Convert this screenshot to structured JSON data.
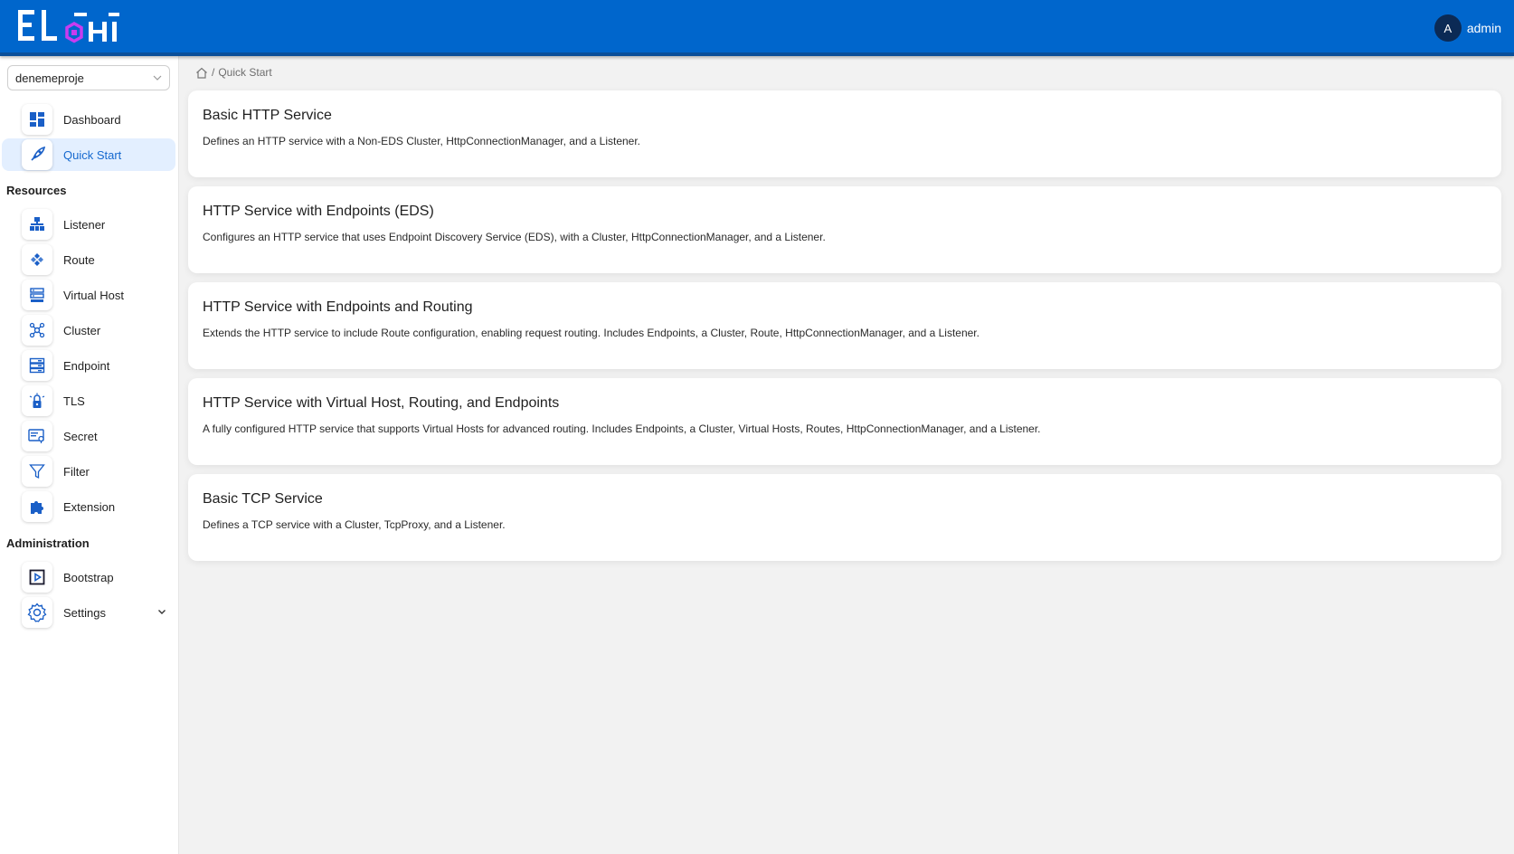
{
  "header": {
    "logo_text": "ELCHI",
    "user": {
      "avatar_initial": "A",
      "name": "admin"
    }
  },
  "sidebar": {
    "project": "denemeproje",
    "top_items": [
      {
        "label": "Dashboard",
        "icon": "dashboard-icon"
      },
      {
        "label": "Quick Start",
        "icon": "rocket-icon",
        "active": true
      }
    ],
    "resources_title": "Resources",
    "resources": [
      {
        "label": "Listener",
        "icon": "listener-icon"
      },
      {
        "label": "Route",
        "icon": "route-icon"
      },
      {
        "label": "Virtual Host",
        "icon": "virtual-host-icon"
      },
      {
        "label": "Cluster",
        "icon": "cluster-icon"
      },
      {
        "label": "Endpoint",
        "icon": "endpoint-icon"
      },
      {
        "label": "TLS",
        "icon": "tls-icon"
      },
      {
        "label": "Secret",
        "icon": "secret-icon"
      },
      {
        "label": "Filter",
        "icon": "filter-icon"
      },
      {
        "label": "Extension",
        "icon": "extension-icon"
      }
    ],
    "administration_title": "Administration",
    "administration": [
      {
        "label": "Bootstrap",
        "icon": "bootstrap-icon"
      },
      {
        "label": "Settings",
        "icon": "gear-icon"
      }
    ]
  },
  "breadcrumb": {
    "separator": "/",
    "current": "Quick Start"
  },
  "cards": [
    {
      "title": "Basic HTTP Service",
      "description": "Defines an HTTP service with a Non-EDS Cluster, HttpConnectionManager, and a Listener."
    },
    {
      "title": "HTTP Service with Endpoints (EDS)",
      "description": "Configures an HTTP service that uses Endpoint Discovery Service (EDS), with a Cluster, HttpConnectionManager, and a Listener."
    },
    {
      "title": "HTTP Service with Endpoints and Routing",
      "description": "Extends the HTTP service to include Route configuration, enabling request routing. Includes Endpoints, a Cluster, Route, HttpConnectionManager, and a Listener."
    },
    {
      "title": "HTTP Service with Virtual Host, Routing, and Endpoints",
      "description": "A fully configured HTTP service that supports Virtual Hosts for advanced routing. Includes Endpoints, a Cluster, Virtual Hosts, Routes, HttpConnectionManager, and a Listener."
    },
    {
      "title": "Basic TCP Service",
      "description": "Defines a TCP service with a Cluster, TcpProxy, and a Listener."
    }
  ],
  "colors": {
    "header": "#0066cc",
    "accent": "#1669cf",
    "icon_blue": "#1a5fc7",
    "active_bg": "#e3efff"
  }
}
